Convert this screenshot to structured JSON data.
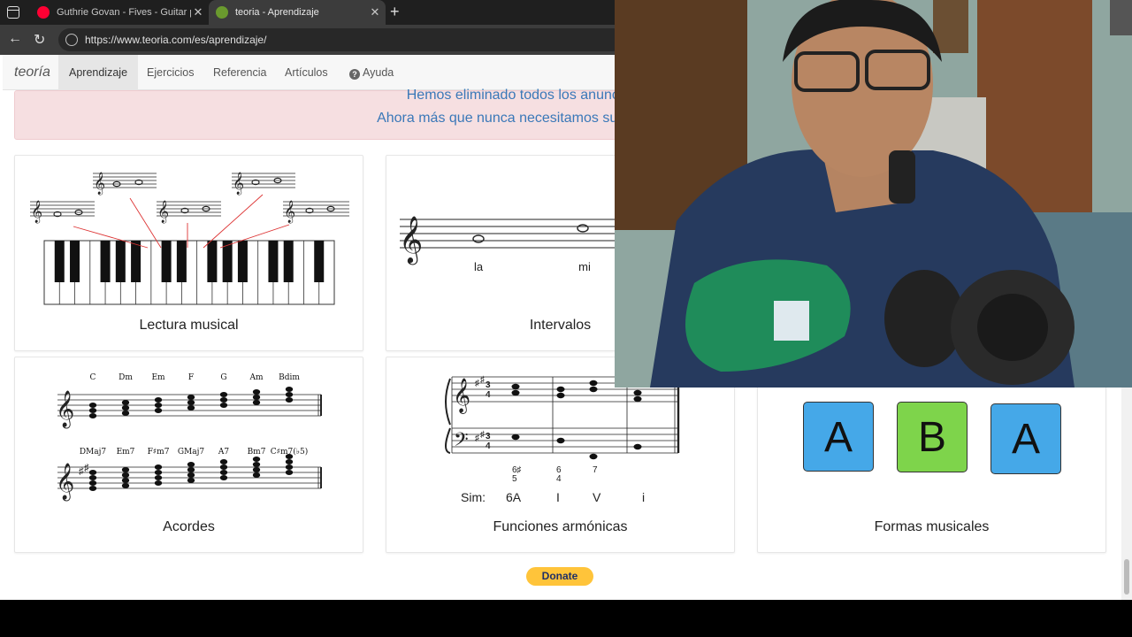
{
  "browser": {
    "tabs": [
      {
        "title": "Guthrie Govan - Fives - Guitar pe",
        "favicon_color": "#ff0033"
      },
      {
        "title": "teoria - Aprendizaje",
        "favicon_color": "#6a9a2e"
      }
    ],
    "url": "https://www.teoria.com/es/aprendizaje/"
  },
  "site": {
    "brand": "teoría",
    "nav": [
      "Aprendizaje",
      "Ejercicios",
      "Referencia",
      "Artículos",
      "Ayuda"
    ],
    "banner_line1": "Hemos eliminado todos los anuncios publicitarios",
    "banner_line2": "Ahora más que nunca necesitamos sus donaciones. ¡Ayúd",
    "cards": {
      "lectura": "Lectura musical",
      "intervalos": "Intervalos",
      "acordes": "Acordes",
      "funciones": "Funciones armónicas",
      "formas": "Formas musicales"
    },
    "intervals_notes": [
      "la",
      "mi"
    ],
    "chord_row1": [
      "C",
      "Dm",
      "Em",
      "F",
      "G",
      "Am",
      "Bdim"
    ],
    "chord_row2": [
      "DMaj7",
      "Em7",
      "F♯m7",
      "GMaj7",
      "A7",
      "Bm7",
      "C♯m7(♭5)"
    ],
    "functions_sim": [
      "Sim:",
      "6A",
      "I",
      "V",
      "i"
    ],
    "functions_figures": [
      "6♯",
      "5",
      "6",
      "4",
      "7"
    ],
    "form_letters": [
      "A",
      "B",
      "A"
    ],
    "form_colors": [
      "#45a8e8",
      "#7ed44b",
      "#45a8e8"
    ],
    "donate": "Donate"
  }
}
